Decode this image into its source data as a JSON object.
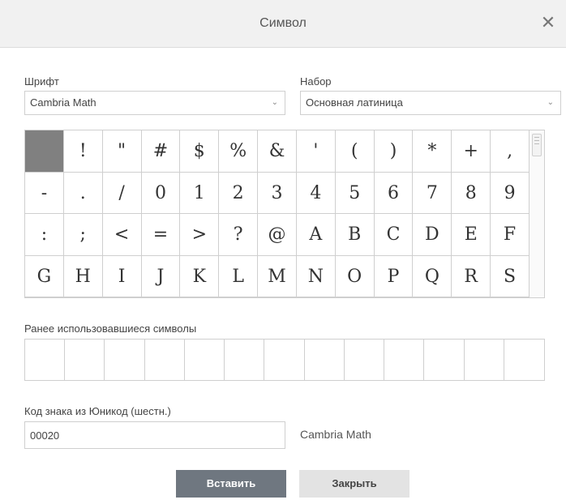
{
  "dialog": {
    "title": "Символ",
    "close_glyph": "✕"
  },
  "font": {
    "label": "Шрифт",
    "value": "Cambria Math"
  },
  "set": {
    "label": "Набор",
    "value": "Основная латиница"
  },
  "symbols": [
    " ",
    "!",
    "\"",
    "#",
    "$",
    "%",
    "&",
    "'",
    "(",
    ")",
    "*",
    "+",
    ",",
    "-",
    ".",
    "/",
    "0",
    "1",
    "2",
    "3",
    "4",
    "5",
    "6",
    "7",
    "8",
    "9",
    ":",
    ";",
    "<",
    "=",
    ">",
    "?",
    "@",
    "A",
    "B",
    "C",
    "D",
    "E",
    "F",
    "G",
    "H",
    "I",
    "J",
    "K",
    "L",
    "M",
    "N",
    "O",
    "P",
    "Q",
    "R",
    "S"
  ],
  "selected_symbol_index": 0,
  "recent": {
    "label": "Ранее использовавшиеся символы",
    "slots": 13
  },
  "unicode": {
    "label": "Код знака из Юникод (шестн.)",
    "value": "00020",
    "font_name": "Cambria Math"
  },
  "buttons": {
    "insert": "Вставить",
    "close": "Закрыть"
  },
  "colors": {
    "primary_button": "#6f7780",
    "selected_cell": "#808080"
  }
}
